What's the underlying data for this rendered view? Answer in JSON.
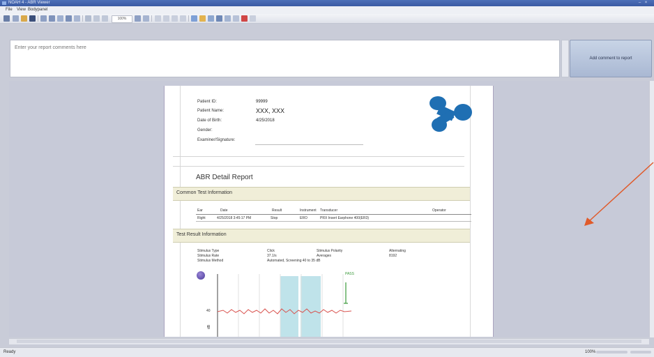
{
  "window": {
    "title": "NOAH 4 - ABR Viewer"
  },
  "menu": {
    "file": "File",
    "view": "View",
    "bodypanel": "Bodypanel"
  },
  "toolbar": {
    "zoom": "100%"
  },
  "comments": {
    "placeholder": "Enter your report comments here"
  },
  "add_button": {
    "label": "Add comment to report"
  },
  "report": {
    "patient_id_label": "Patient ID:",
    "patient_id": "99999",
    "patient_name_label": "Patient Name:",
    "patient_name": "XXX, XXX",
    "dob_label": "Date of Birth:",
    "dob": "4/25/2018",
    "gender_label": "Gender:",
    "examiner_label": "Examiner/Signature:",
    "title": "ABR Detail Report",
    "band1": "Common Test Information",
    "cols": [
      "Ear",
      "Date",
      "Result",
      "Instrument",
      "Transducer",
      "Operator"
    ],
    "row": [
      "Right",
      "4/25/2018 3:45:17 PM",
      "Stop",
      "ERO",
      "PRX Insert Earphone 400(ER3)",
      ""
    ],
    "band2": "Test Result Information",
    "stim_type_label": "Stimulus Type",
    "stim_type": "Click",
    "stim_rate_label": "Stimulus Rate",
    "stim_rate": "37.1/s",
    "stim_polarity_label": "Stimulus Polarity",
    "stim_polarity": "Alternating",
    "stim_method_label": "Stimulus Method",
    "stim_method": "Automated, Screening 40 to 35 dB",
    "averages_label": "Averages",
    "averages": "8192",
    "pass_label": "PASS",
    "y_label": "40"
  },
  "statusbar": {
    "status": "Ready",
    "zoom": "100%"
  },
  "colors": {
    "titlebar": "#3a5aa3",
    "logo": "#1f6fb3",
    "arrow": "#e05a2a",
    "band": "#f0eed8",
    "gate": "#bfe3ea"
  }
}
